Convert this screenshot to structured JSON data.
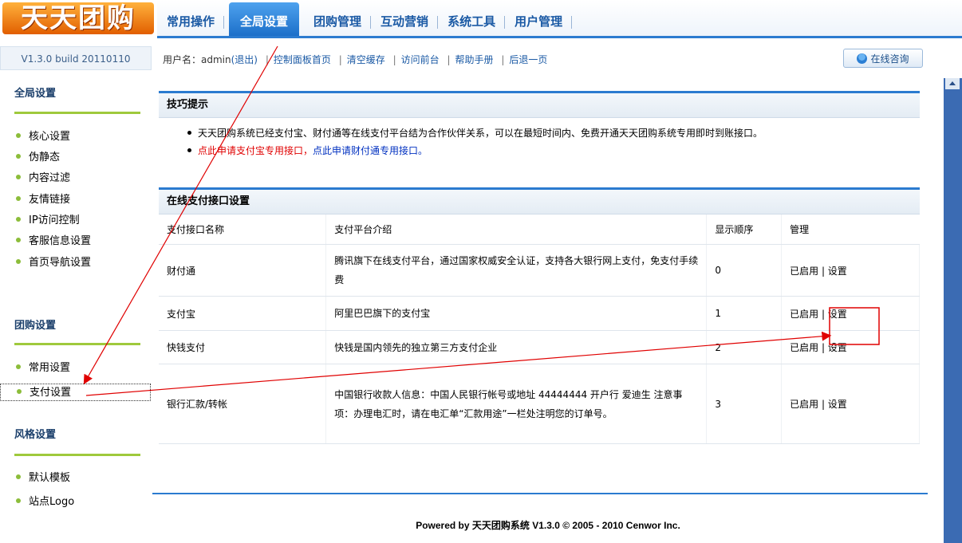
{
  "app": {
    "logo_text": "天天团购",
    "version": "V1.3.0 build 20110110"
  },
  "nav": {
    "tabs": [
      {
        "label": "常用操作"
      },
      {
        "label": "全局设置",
        "active": true
      },
      {
        "label": "团购管理"
      },
      {
        "label": "互动营销"
      },
      {
        "label": "系统工具"
      },
      {
        "label": "用户管理"
      }
    ]
  },
  "topbar": {
    "user_prefix": "用户名：admin",
    "logout": "(退出)",
    "links": [
      "控制面板首页",
      "清空缓存",
      "访问前台",
      "帮助手册",
      "后退一页"
    ],
    "consult_button": "在线咨询"
  },
  "sidebar": {
    "sections": [
      {
        "title": "全局设置",
        "items": [
          "核心设置",
          "伪静态",
          "内容过滤",
          "友情链接",
          "IP访问控制",
          "客服信息设置",
          "首页导航设置"
        ]
      },
      {
        "title": "团购设置",
        "items": [
          "常用设置",
          "支付设置"
        ]
      },
      {
        "title": "风格设置",
        "items": [
          "默认模板",
          "站点Logo"
        ]
      }
    ],
    "active_item": "支付设置"
  },
  "tips": {
    "title": "技巧提示",
    "line1": "天天团购系统已经支付宝、财付通等在线支付平台结为合作伙伴关系，可以在最短时间内、免费开通天天团购系统专用即时到账接口。",
    "link_alipay": "点此申请支付宝专用接口，",
    "link_tenpay": "点此申请财付通专用接口。"
  },
  "payments": {
    "title": "在线支付接口设置",
    "headers": [
      "支付接口名称",
      "支付平台介绍",
      "显示顺序",
      "管理"
    ],
    "rows": [
      {
        "name": "财付通",
        "desc": "腾讯旗下在线支付平台，通过国家权威安全认证，支持各大银行网上支付，免支付手续费",
        "order": "0",
        "status": "已启用",
        "action": "设置"
      },
      {
        "name": "支付宝",
        "desc": "阿里巴巴旗下的支付宝",
        "order": "1",
        "status": "已启用",
        "action": "设置"
      },
      {
        "name": "快钱支付",
        "desc": "快钱是国内领先的独立第三方支付企业",
        "order": "2",
        "status": "已启用",
        "action": "设置"
      },
      {
        "name": "银行汇款/转帐",
        "desc": "中国银行收款人信息：中国人民银行帐号或地址 44444444 开户行 爱迪生 注意事项：办理电汇时，请在电汇单“汇款用途”一栏处注明您的订单号。",
        "order": "3",
        "status": "已启用",
        "action": "设置"
      }
    ]
  },
  "footer": {
    "text": "Powered by 天天团购系统  V1.3.0 © 2005 - 2010 Cenwor Inc."
  },
  "annotation": {
    "color": "#e00000"
  }
}
